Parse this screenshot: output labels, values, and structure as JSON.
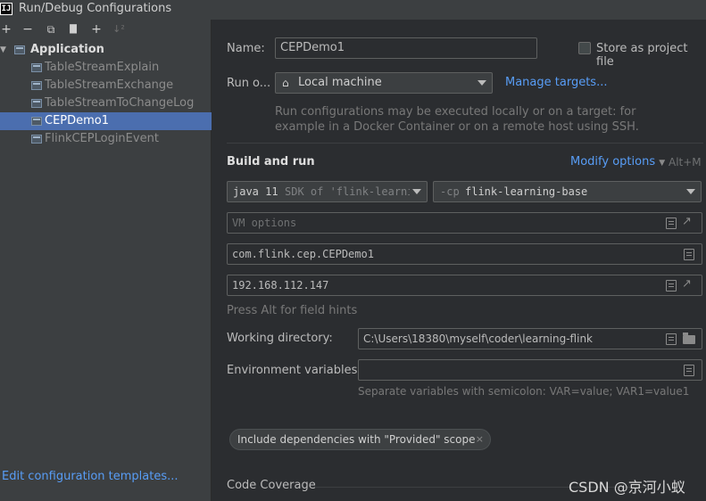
{
  "window": {
    "title": "Run/Debug Configurations",
    "logo_text": "IJ"
  },
  "toolbar": {
    "add": "+",
    "remove": "−",
    "copy": "⧉",
    "save": "▇",
    "new_folder": "+",
    "sort": "↓²"
  },
  "tree": {
    "group_label": "Application",
    "items": [
      {
        "label": "TableStreamExplain"
      },
      {
        "label": "TableStreamExchange"
      },
      {
        "label": "TableStreamToChangeLog"
      },
      {
        "label": "CEPDemo1"
      },
      {
        "label": "FlinkCEPLoginEvent"
      }
    ]
  },
  "left_footer": {
    "edit_templates": "Edit configuration templates..."
  },
  "form": {
    "name_label": "Name:",
    "name_value": "CEPDemo1",
    "store_label": "Store as project file",
    "run_on_label": "Run o...",
    "run_on_value": "Local machine",
    "manage_targets": "Manage targets...",
    "run_hint_line1": "Run configurations may be executed locally or on a target: for",
    "run_hint_line2": "example in a Docker Container or on a remote host using SSH.",
    "build_run_title": "Build and run",
    "modify_options": "Modify options",
    "modify_shortcut": "Alt+M",
    "jdk_bold": "java 11",
    "jdk_dim": "SDK of 'flink-learni",
    "cp_flag": "-cp",
    "cp_value": "flink-learning-base",
    "vm_placeholder": "VM options",
    "main_class": "com.flink.cep.CEPDemo1",
    "program_args": "192.168.112.147",
    "field_hints": "Press Alt for field hints",
    "workdir_label": "Working directory:",
    "workdir_value": "C:\\Users\\18380\\myself\\coder\\learning-flink",
    "env_label": "Environment variables:",
    "env_value": "",
    "env_hint": "Separate variables with semicolon: VAR=value; VAR1=value1",
    "chip_label": "Include dependencies with \"Provided\" scope",
    "chip_close": "×",
    "code_coverage": "Code Coverage"
  },
  "watermark": "CSDN @京河小蚁"
}
